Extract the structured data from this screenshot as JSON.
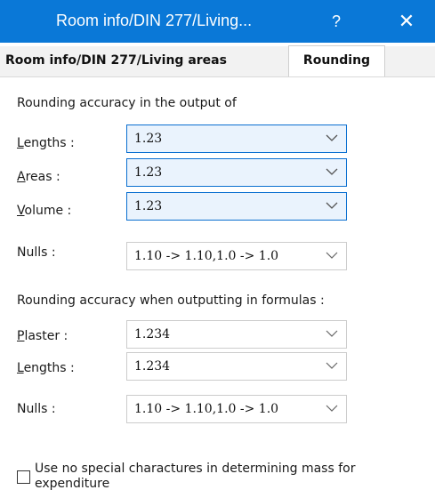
{
  "window": {
    "title": "Room info/DIN 277/Living...",
    "help_glyph": "?",
    "close_glyph": "✕"
  },
  "tabs": [
    {
      "label": "Room info/DIN 277/Living areas",
      "active": false
    },
    {
      "label": "Rounding",
      "active": true
    }
  ],
  "output_section": {
    "heading": "Rounding accuracy in the output of",
    "fields": [
      {
        "label_mnemonic": "L",
        "label_rest": "engths :",
        "value": "1.23"
      },
      {
        "label_mnemonic": "A",
        "label_rest": "reas :",
        "value": "1.23"
      },
      {
        "label_mnemonic": "V",
        "label_rest": "olume :",
        "value": "1.23"
      },
      {
        "label_mnemonic": "",
        "label_rest": "Nulls :",
        "value": "1.10 -> 1.10,1.0 -> 1.0"
      }
    ]
  },
  "formula_section": {
    "heading": "Rounding accuracy when outputting in formulas :",
    "fields": [
      {
        "label_mnemonic": "P",
        "label_rest": "laster :",
        "value": "1.234"
      },
      {
        "label_mnemonic": "L",
        "label_rest": "engths :",
        "value": "1.234"
      },
      {
        "label_mnemonic": "",
        "label_rest": "Nulls :",
        "value": "1.10 -> 1.10,1.0 -> 1.0"
      }
    ]
  },
  "checkbox": {
    "label": "Use no special charactures in determining mass for expenditure",
    "checked": false
  },
  "colors": {
    "titlebar": "#0a78d7",
    "focus_border": "#0a6fd0",
    "focus_fill": "#eaf3fd"
  }
}
